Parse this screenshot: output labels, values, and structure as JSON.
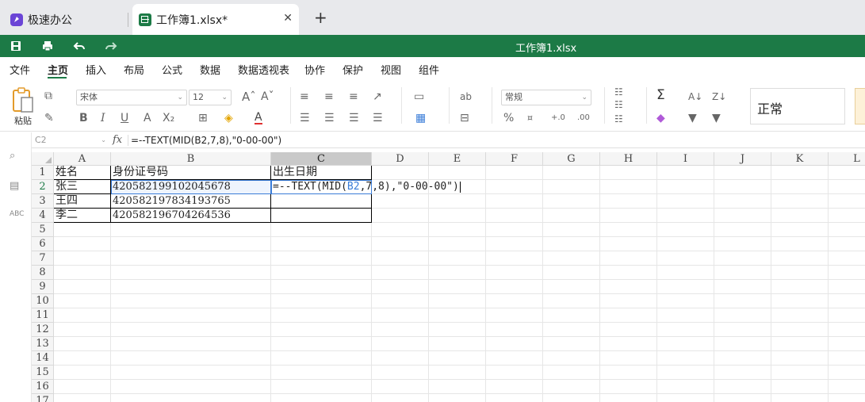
{
  "tabs": {
    "home_label": "极速办公",
    "doc_label": "工作簿1.xlsx*"
  },
  "title": "工作簿1.xlsx",
  "menu": [
    "文件",
    "主页",
    "插入",
    "布局",
    "公式",
    "数据",
    "数据透视表",
    "协作",
    "保护",
    "视图",
    "组件"
  ],
  "toolbar": {
    "paste_label": "粘贴",
    "font_name": "宋体",
    "font_size": "12",
    "number_format": "常规",
    "cell_style": "正常"
  },
  "formula_bar": {
    "name_box": "C2",
    "fx": "fx",
    "formula": "=--TEXT(MID(B2,7,8),\"0-00-00\")"
  },
  "columns": [
    "A",
    "B",
    "C",
    "D",
    "E",
    "F",
    "G",
    "H",
    "I",
    "J",
    "K",
    "L"
  ],
  "rows": [
    "1",
    "2",
    "3",
    "4",
    "5",
    "6",
    "7",
    "8",
    "9",
    "10",
    "11",
    "12",
    "13",
    "14",
    "15",
    "16",
    "17"
  ],
  "cells": {
    "A1": "姓名",
    "B1": "身份证号码",
    "C1": "出生日期",
    "A2": "张三",
    "B2": "420582199102045678",
    "A3": "王四",
    "B3": "420582197834193765",
    "A4": "李二",
    "B4": "420582196704264536"
  },
  "editing": {
    "prefix": "=--TEXT(MID(",
    "ref": "B2",
    "suffix": ",7,8),\"0-00-00\")"
  },
  "colors": {
    "brand": "#1c7a46",
    "selection": "#3b7dd8"
  }
}
